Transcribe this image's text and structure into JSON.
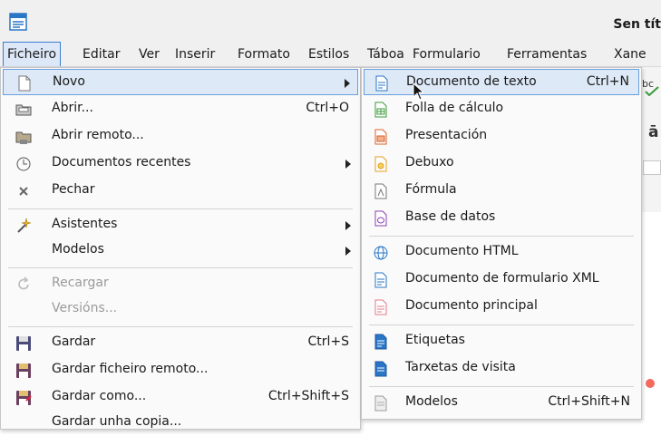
{
  "window": {
    "title": "Sen tít"
  },
  "menubar": {
    "items": [
      {
        "label": "Ficheiro",
        "active": true
      },
      {
        "label": "Editar"
      },
      {
        "label": "Ver"
      },
      {
        "label": "Inserir"
      },
      {
        "label": "Formato"
      },
      {
        "label": "Estilos"
      },
      {
        "label": "Táboa"
      },
      {
        "label": "Formulario"
      },
      {
        "label": "Ferramentas"
      },
      {
        "label": "Xane"
      }
    ]
  },
  "background": {
    "toolbar_glyph": "ā"
  },
  "file_menu": {
    "items": [
      {
        "label": "Novo",
        "icon": "new-document-icon",
        "submenu": true,
        "highlighted": true
      },
      {
        "label": "Abrir...",
        "shortcut": "Ctrl+O",
        "icon": "open-folder-icon"
      },
      {
        "label": "Abrir remoto...",
        "icon": "remote-folder-icon"
      },
      {
        "label": "Documentos recentes",
        "icon": "clock-icon",
        "submenu": true
      },
      {
        "label": "Pechar",
        "icon": "close-x-icon"
      },
      {
        "label": "Asistentes",
        "icon": "magic-wand-icon",
        "submenu": true
      },
      {
        "label": "Modelos",
        "submenu": true
      },
      {
        "label": "Recargar",
        "icon": "reload-icon",
        "disabled": true
      },
      {
        "label": "Versións...",
        "disabled": true
      },
      {
        "label": "Gardar",
        "shortcut": "Ctrl+S",
        "icon": "floppy-disk-icon"
      },
      {
        "label": "Gardar ficheiro remoto...",
        "icon": "floppy-remote-icon"
      },
      {
        "label": "Gardar como...",
        "shortcut": "Ctrl+Shift+S",
        "icon": "floppy-save-as-icon"
      },
      {
        "label": "Gardar unha copia..."
      }
    ]
  },
  "new_submenu": {
    "items": [
      {
        "label": "Documento de texto",
        "shortcut": "Ctrl+N",
        "icon": "text-document-icon",
        "highlighted": true
      },
      {
        "label": "Folla de cálculo",
        "icon": "spreadsheet-icon"
      },
      {
        "label": "Presentación",
        "icon": "presentation-icon"
      },
      {
        "label": "Debuxo",
        "icon": "drawing-icon"
      },
      {
        "label": "Fórmula",
        "icon": "formula-icon"
      },
      {
        "label": "Base de datos",
        "icon": "database-icon"
      },
      {
        "label": "Documento HTML",
        "icon": "globe-icon"
      },
      {
        "label": "Documento de formulario XML",
        "icon": "xml-form-icon"
      },
      {
        "label": "Documento principal",
        "icon": "master-document-icon"
      },
      {
        "label": "Etiquetas",
        "icon": "labels-icon"
      },
      {
        "label": "Tarxetas de visita",
        "icon": "business-cards-icon"
      },
      {
        "label": "Modelos",
        "shortcut": "Ctrl+Shift+N",
        "icon": "templates-icon"
      }
    ]
  },
  "colors": {
    "highlight_bg": "#dde9f7",
    "highlight_border": "#6a9fdc",
    "marker": "#f4685d",
    "writer_blue": "#2a76c6"
  }
}
